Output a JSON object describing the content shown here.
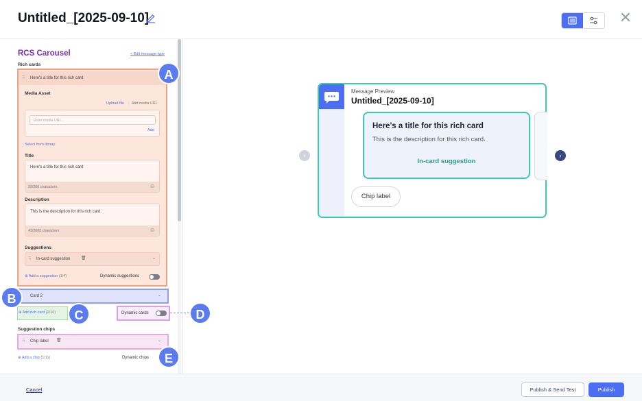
{
  "header": {
    "title": "Untitled_[2025-09-10]"
  },
  "editor": {
    "section_title": "RCS Carousel",
    "edit_message_type": "< Edit message type",
    "rich_cards_label": "Rich cards",
    "card1": {
      "header_title": "Here's a title for this rich card",
      "media_asset_label": "Media Asset",
      "upload_file": "Upload file",
      "add_media_url": "Add media URL",
      "media_url_placeholder": "Enter media URL...",
      "add_label": "Add",
      "select_from_library": "Select from library",
      "title_label": "Title",
      "title_value": "Here's a title for this rich card",
      "title_counter": "33/200 characters",
      "description_label": "Description",
      "description_value": "This is the description for this rich card.",
      "description_counter": "43/2000 characters",
      "suggestions_label": "Suggestions",
      "suggestion_item": "In-card suggestion",
      "add_suggestion": "Add a suggestion",
      "suggestion_count": "(1/4)",
      "dynamic_suggestions": "Dynamic suggestions"
    },
    "card2_label": "Card 2",
    "add_rich_card": "Add rich card",
    "rich_card_count": "(2/10)",
    "dynamic_cards": "Dynamic cards",
    "suggestion_chips_label": "Suggestion chips",
    "chip_item": "Chip label",
    "add_chip": "Add a chip",
    "chip_count": "(1/11)",
    "dynamic_chips": "Dynamic chips"
  },
  "badges": [
    "A",
    "B",
    "C",
    "D",
    "E"
  ],
  "preview": {
    "caption": "Message Preview",
    "title": "Untitled_[2025-09-10]",
    "card_title": "Here's a title for this rich card",
    "card_description": "This is the description for this rich card.",
    "card_suggestion": "In-card suggestion",
    "chip_label": "Chip label"
  },
  "footer": {
    "cancel": "Cancel",
    "publish_send_test": "Publish & Send Test",
    "publish": "Publish"
  },
  "colors": {
    "accent": "#4c6ef5",
    "teal": "#3cc9b8",
    "purple": "#7b2fb5"
  }
}
